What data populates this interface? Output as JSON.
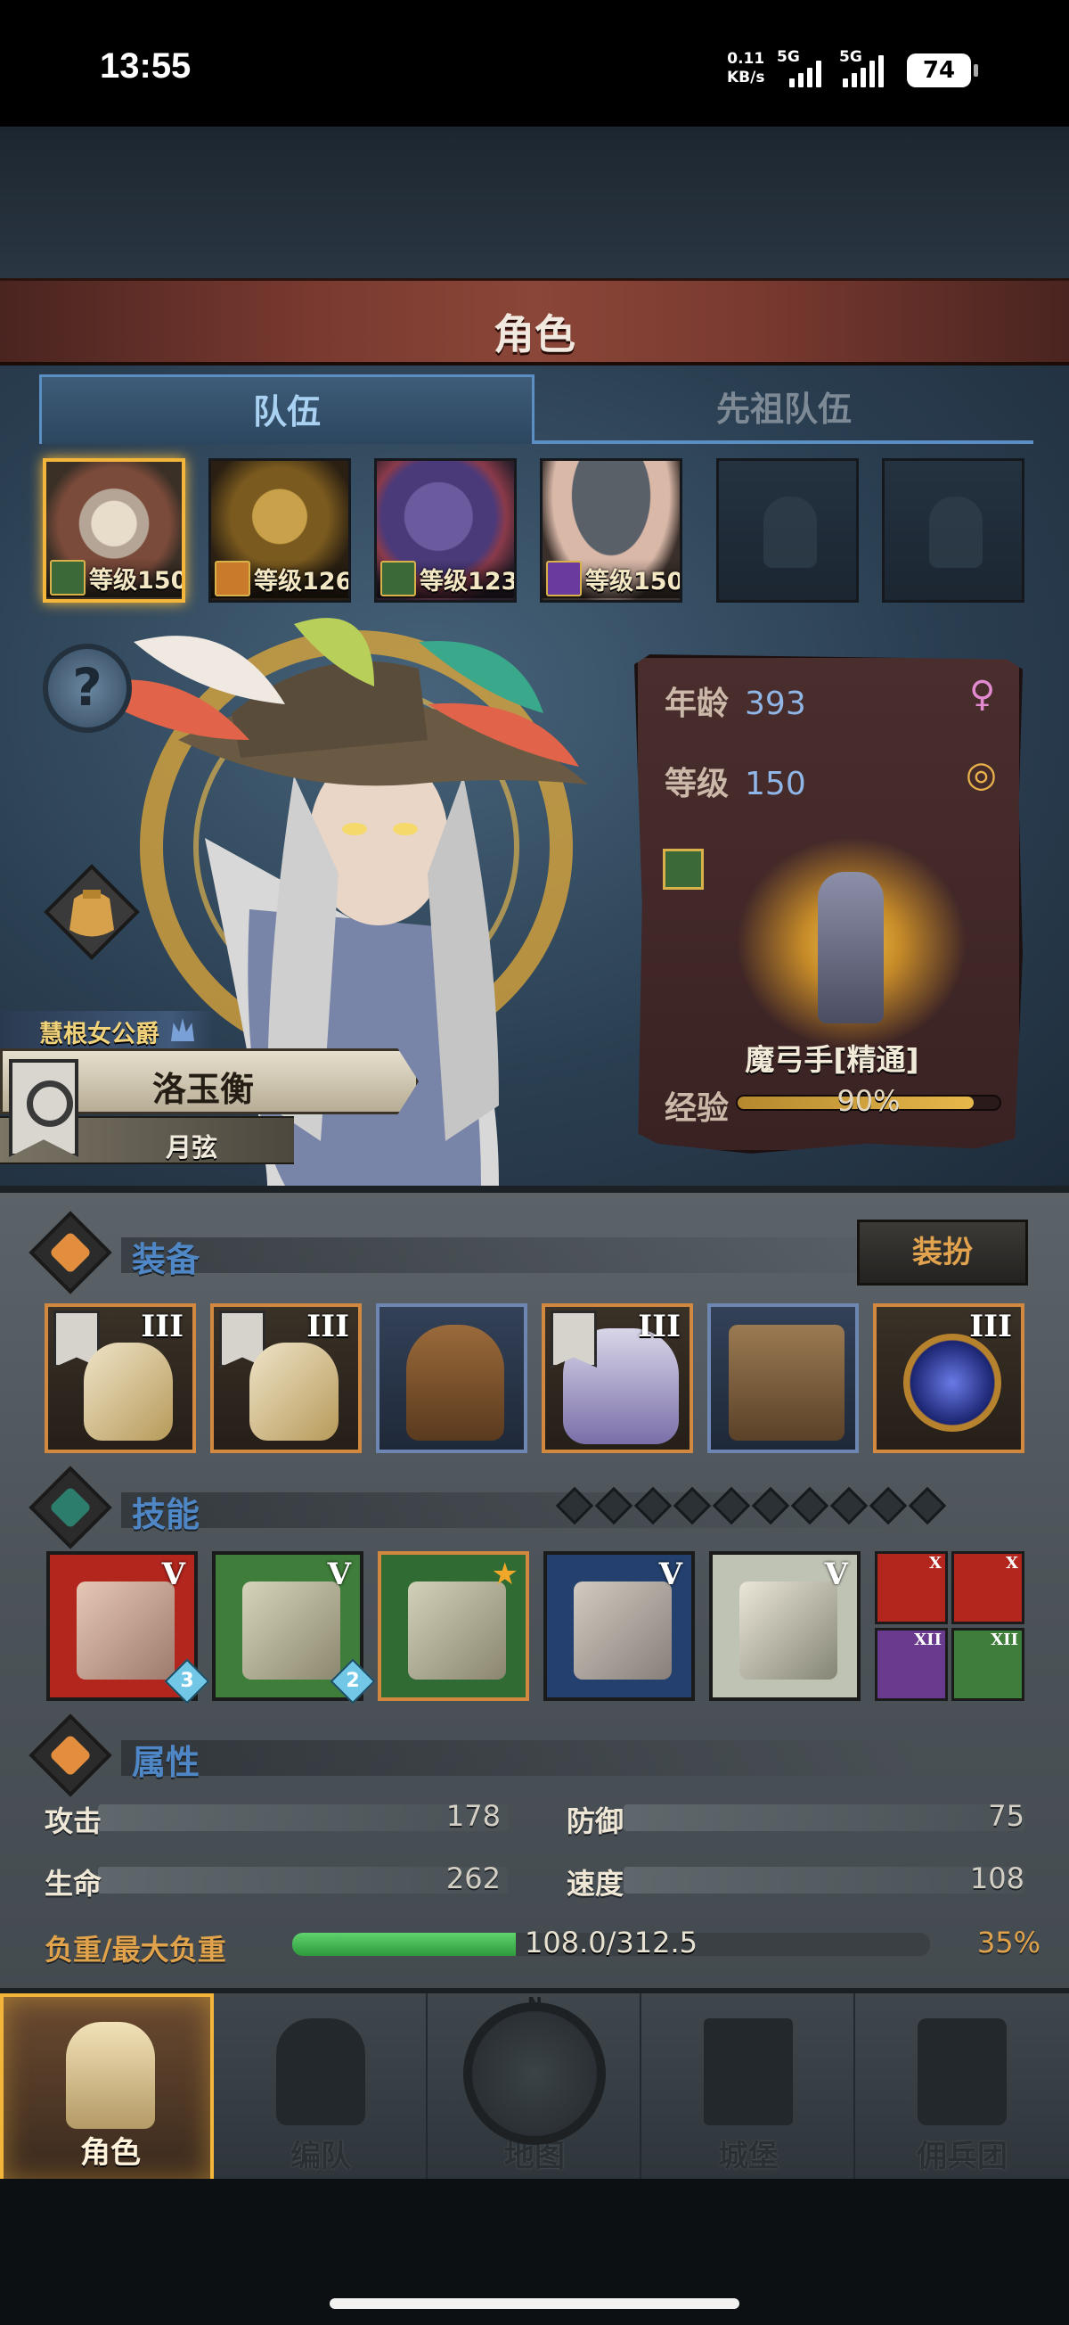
{
  "status_bar": {
    "time": "13:55",
    "net_speed_value": "0.11",
    "net_speed_unit": "KB/s",
    "sim1": "5G",
    "sim2": "5G",
    "battery": "74"
  },
  "screen_title": "角色",
  "tabs": [
    {
      "label": "队伍",
      "active": true
    },
    {
      "label": "先祖队伍",
      "active": false
    }
  ],
  "party": [
    {
      "level_label": "等级150",
      "class_icon": "bow-class-icon",
      "selected": true
    },
    {
      "level_label": "等级126",
      "class_icon": "horse-class-icon",
      "selected": false
    },
    {
      "level_label": "等级123",
      "class_icon": "bow-class-icon",
      "selected": false
    },
    {
      "level_label": "等级150",
      "class_icon": "staff-class-icon",
      "selected": false
    },
    {
      "empty": true
    },
    {
      "empty": true
    }
  ],
  "help_icon": "?",
  "hero": {
    "title": "慧根女公爵",
    "name": "洛玉衡",
    "subtitle": "月弦"
  },
  "info_card": {
    "age_label": "年龄",
    "age_value": "393",
    "gender_icon": "female-icon",
    "level_label": "等级",
    "level_value": "150",
    "ring_icon": "ring-icon",
    "class_name": "魔弓手[精通]",
    "exp_label": "经验",
    "exp_percent_text": "90%",
    "exp_fraction": 0.9
  },
  "equipment": {
    "section_title": "装备",
    "dress_button": "装扮",
    "items": [
      {
        "name": "weapon-1",
        "tier": "III",
        "rarity": "orange",
        "banner": true
      },
      {
        "name": "weapon-2",
        "tier": "III",
        "rarity": "orange",
        "banner": true
      },
      {
        "name": "helmet",
        "tier": "",
        "rarity": "blue",
        "banner": false
      },
      {
        "name": "armor",
        "tier": "III",
        "rarity": "orange",
        "banner": true
      },
      {
        "name": "boots",
        "tier": "",
        "rarity": "blue",
        "banner": false
      },
      {
        "name": "accessory-orb",
        "tier": "III",
        "rarity": "orange",
        "banner": false
      }
    ]
  },
  "skills": {
    "section_title": "技能",
    "pip_count": 10,
    "items": [
      {
        "tier": "V",
        "gem": "3",
        "color": "#b3261e"
      },
      {
        "tier": "V",
        "gem": "2",
        "color": "#3f7d3a"
      },
      {
        "tier": "",
        "gem": "",
        "star": true,
        "color": "#2f6b33"
      },
      {
        "tier": "V",
        "gem": "",
        "color": "#23406e"
      },
      {
        "tier": "V",
        "gem": "",
        "color": "#bfc3b4"
      }
    ],
    "mini": [
      {
        "tier": "X",
        "color": "#b3261e"
      },
      {
        "tier": "X",
        "color": "#b3261e"
      },
      {
        "tier": "XII",
        "color": "#6a3a8e"
      },
      {
        "tier": "XII",
        "color": "#3f7d3a"
      }
    ]
  },
  "attributes": {
    "section_title": "属性",
    "attack_label": "攻击",
    "attack_value": "178",
    "defense_label": "防御",
    "defense_value": "75",
    "hp_label": "生命",
    "hp_value": "262",
    "speed_label": "速度",
    "speed_value": "108",
    "load_label": "负重/最大负重",
    "load_value": "108.0/312.5",
    "load_percent": "35%",
    "load_fraction": 0.35
  },
  "nav": [
    {
      "label": "角色",
      "icon": "knight-icon",
      "active": true
    },
    {
      "label": "编队",
      "icon": "helmet-icon",
      "active": false
    },
    {
      "label": "地图",
      "icon": "compass-icon",
      "active": false
    },
    {
      "label": "城堡",
      "icon": "castle-icon",
      "active": false
    },
    {
      "label": "佣兵团",
      "icon": "mercenary-icon",
      "active": false
    }
  ],
  "compass_letter": "N",
  "colors": {
    "accent_gold": "#f3b63a",
    "tab_blue": "#5b8fc4",
    "section_blue": "#4f87c6",
    "load_orange": "#e0a24a"
  }
}
